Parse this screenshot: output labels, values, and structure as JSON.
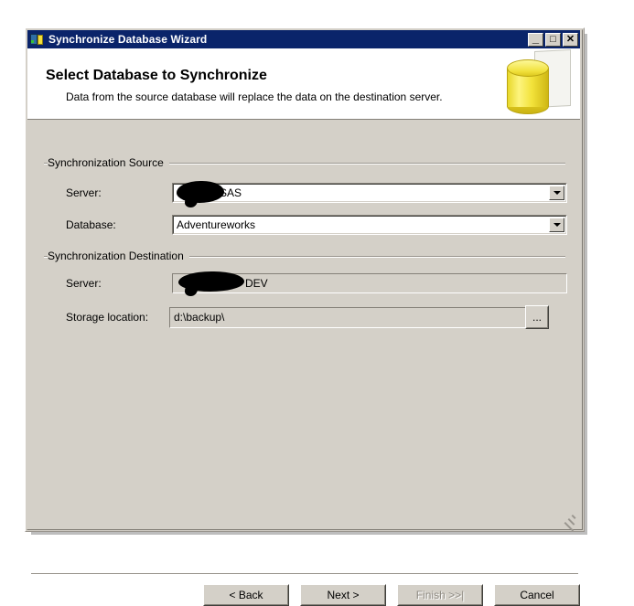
{
  "window": {
    "title": "Synchronize Database Wizard",
    "icon": "database-server-icon",
    "controls": {
      "minimize": "_",
      "maximize": "□",
      "close": "✕"
    }
  },
  "banner": {
    "title": "Select Database to Synchronize",
    "subtitle": "Data from the source database will replace the data on the destination server.",
    "art": "yellow-database-cylinder"
  },
  "source": {
    "group_label": "Synchronization Source",
    "server": {
      "label": "Server:",
      "value": "SAS",
      "redacted": true
    },
    "database": {
      "label": "Database:",
      "value": "Adventureworks"
    }
  },
  "destination": {
    "group_label": "Synchronization Destination",
    "server": {
      "label": "Server:",
      "value": "DEV",
      "redacted": true
    },
    "storage": {
      "label": "Storage location:",
      "value": "d:\\backup\\",
      "browse_label": "..."
    }
  },
  "footer": {
    "back": "< Back",
    "next": "Next >",
    "finish": "Finish >>|",
    "cancel": "Cancel"
  },
  "colors": {
    "titlebar": "#0a246a",
    "face": "#d4d0c8",
    "banner": "#ffffff",
    "accent": "#f2e23a"
  }
}
